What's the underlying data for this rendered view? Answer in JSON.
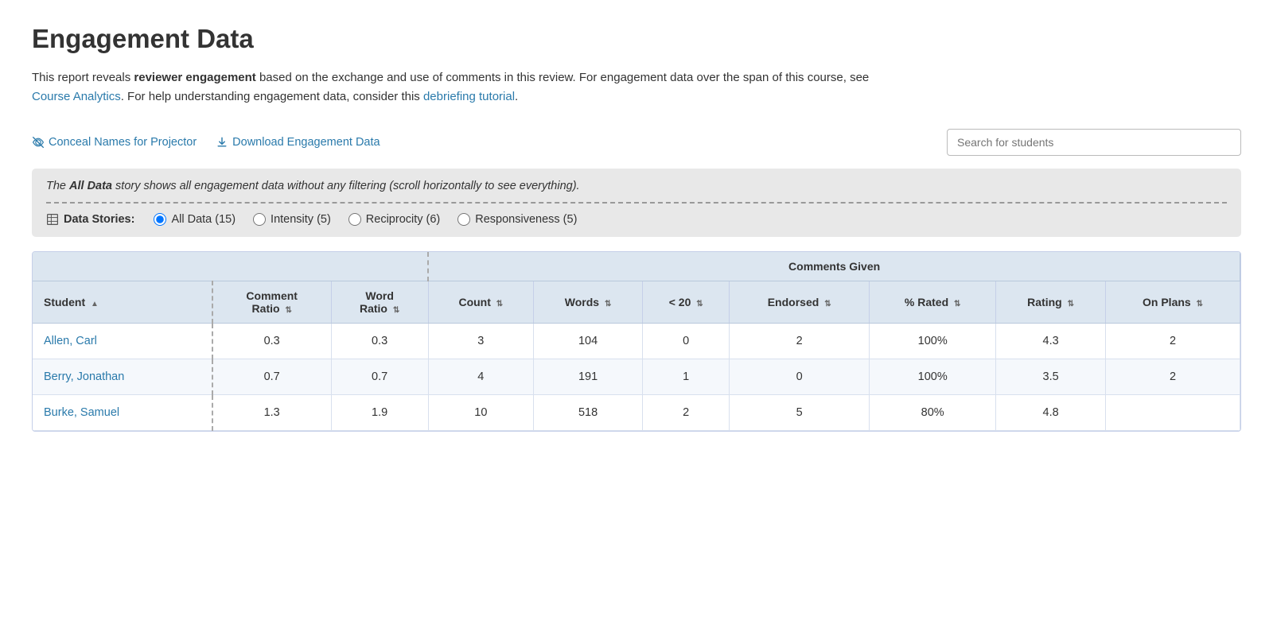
{
  "page": {
    "title": "Engagement Data",
    "description_parts": [
      {
        "type": "text",
        "content": "This report reveals "
      },
      {
        "type": "bold",
        "content": "reviewer engagement"
      },
      {
        "type": "text",
        "content": " based on the exchange and use of comments in this review. For engagement data over the span of this course, see "
      },
      {
        "type": "link",
        "content": "Course Analytics",
        "href": "#"
      },
      {
        "type": "text",
        "content": ". For help understanding engagement data, consider this "
      },
      {
        "type": "link",
        "content": "debriefing tutorial",
        "href": "#"
      },
      {
        "type": "text",
        "content": "."
      }
    ]
  },
  "toolbar": {
    "conceal_label": "Conceal Names for Projector",
    "download_label": "Download Engagement Data",
    "search_placeholder": "Search for students"
  },
  "info_box": {
    "text_before": "The ",
    "bold_text": "All Data",
    "text_after": " story shows all engagement data without any filtering (scroll horizontally to see everything)."
  },
  "data_stories": {
    "label": "Data Stories:",
    "options": [
      {
        "id": "all-data",
        "label": "All Data (15)",
        "checked": true
      },
      {
        "id": "intensity",
        "label": "Intensity (5)",
        "checked": false
      },
      {
        "id": "reciprocity",
        "label": "Reciprocity (6)",
        "checked": false
      },
      {
        "id": "responsiveness",
        "label": "Responsiveness (5)",
        "checked": false
      }
    ]
  },
  "table": {
    "group_headers": [
      {
        "label": "",
        "colspan": 3
      },
      {
        "label": "Comments Given",
        "colspan": 7
      }
    ],
    "col_headers": [
      {
        "label": "Student",
        "sortable": true,
        "sort_dir": "asc"
      },
      {
        "label": "Comment Ratio",
        "sortable": true
      },
      {
        "label": "Word Ratio",
        "sortable": true
      },
      {
        "label": "Count",
        "sortable": true
      },
      {
        "label": "Words",
        "sortable": true
      },
      {
        "label": "< 20",
        "sortable": true
      },
      {
        "label": "Endorsed",
        "sortable": true
      },
      {
        "label": "% Rated",
        "sortable": true
      },
      {
        "label": "Rating",
        "sortable": true
      },
      {
        "label": "On Plans",
        "sortable": true
      }
    ],
    "rows": [
      {
        "student": "Allen, Carl",
        "comment_ratio": "0.3",
        "word_ratio": "0.3",
        "count": "3",
        "words": "104",
        "lt20": "0",
        "endorsed": "2",
        "pct_rated": "100%",
        "rating": "4.3",
        "on_plans": "2"
      },
      {
        "student": "Berry, Jonathan",
        "comment_ratio": "0.7",
        "word_ratio": "0.7",
        "count": "4",
        "words": "191",
        "lt20": "1",
        "endorsed": "0",
        "pct_rated": "100%",
        "rating": "3.5",
        "on_plans": "2"
      },
      {
        "student": "Burke, Samuel",
        "comment_ratio": "1.3",
        "word_ratio": "1.9",
        "count": "10",
        "words": "518",
        "lt20": "2",
        "endorsed": "5",
        "pct_rated": "80%",
        "rating": "4.8",
        "on_plans": ""
      }
    ]
  }
}
